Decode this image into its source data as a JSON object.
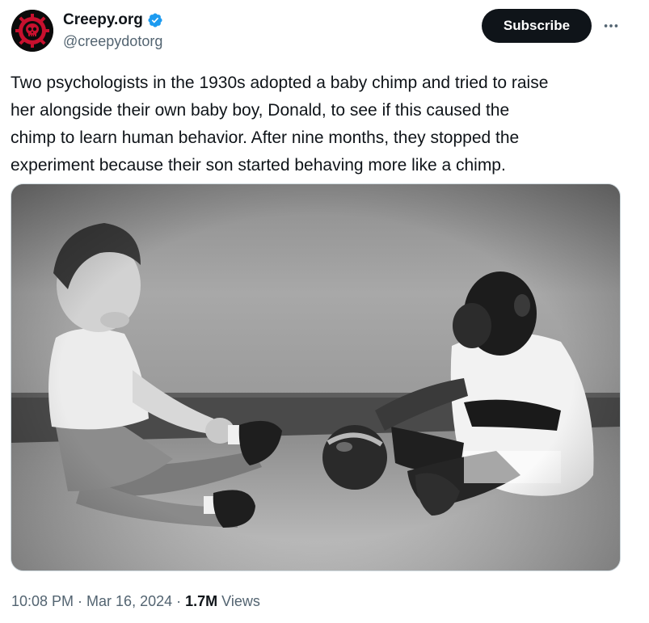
{
  "author": {
    "display_name": "Creepy.org",
    "handle": "@creepydotorg",
    "verified": true,
    "avatar_icon": "skull-logo-icon",
    "verified_icon": "verified-badge-icon"
  },
  "actions": {
    "subscribe_label": "Subscribe",
    "more_icon": "more-options-icon"
  },
  "tweet": {
    "text": "Two psychologists in the 1930s adopted a baby chimp and tried to raise\nher alongside their own baby boy, Donald, to see if this caused the\nchimp to learn human behavior. After nine months, they stopped the\nexperiment because their son started behaving more like a chimp."
  },
  "media": {
    "type": "black-and-white photo",
    "subject": "baby-and-chimp-photo"
  },
  "meta": {
    "time": "10:08 PM",
    "separator": "·",
    "date": "Mar 16, 2024",
    "views_count": "1.7M",
    "views_label": "Views"
  },
  "colors": {
    "text_primary": "#0f1419",
    "text_secondary": "#536471",
    "verified_blue": "#1d9bf0",
    "button_bg": "#0f1419",
    "avatar_red": "#c8102e"
  }
}
